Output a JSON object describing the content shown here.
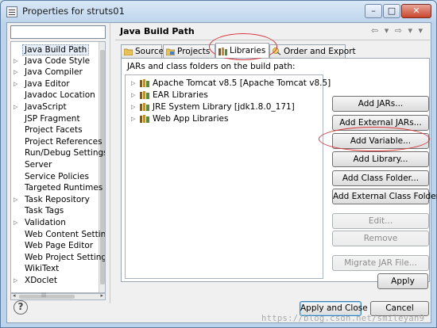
{
  "window": {
    "title": "Properties for struts01",
    "controls": [
      "–",
      "□",
      "✕"
    ]
  },
  "sidebar": {
    "filter_value": "",
    "items": [
      {
        "label": "Java Build Path",
        "expandable": false,
        "selected": true
      },
      {
        "label": "Java Code Style",
        "expandable": true
      },
      {
        "label": "Java Compiler",
        "expandable": true
      },
      {
        "label": "Java Editor",
        "expandable": true
      },
      {
        "label": "Javadoc Location",
        "expandable": false
      },
      {
        "label": "JavaScript",
        "expandable": true
      },
      {
        "label": "JSP Fragment",
        "expandable": false
      },
      {
        "label": "Project Facets",
        "expandable": false
      },
      {
        "label": "Project References",
        "expandable": false
      },
      {
        "label": "Run/Debug Settings",
        "expandable": false
      },
      {
        "label": "Server",
        "expandable": false
      },
      {
        "label": "Service Policies",
        "expandable": false
      },
      {
        "label": "Targeted Runtimes",
        "expandable": false
      },
      {
        "label": "Task Repository",
        "expandable": true
      },
      {
        "label": "Task Tags",
        "expandable": false
      },
      {
        "label": "Validation",
        "expandable": true
      },
      {
        "label": "Web Content Settings",
        "expandable": false
      },
      {
        "label": "Web Page Editor",
        "expandable": false
      },
      {
        "label": "Web Project Settings",
        "expandable": false
      },
      {
        "label": "WikiText",
        "expandable": false
      },
      {
        "label": "XDoclet",
        "expandable": true
      }
    ],
    "scroll_left": "◂",
    "scroll_right": "▸",
    "scroll_grip": "|||"
  },
  "page": {
    "title": "Java Build Path",
    "nav": "⇦ ▾ ⇨ ▾ ▾",
    "tabs": [
      {
        "label": "Source",
        "active": false
      },
      {
        "label": "Projects",
        "active": false
      },
      {
        "label": "Libraries",
        "active": true
      },
      {
        "label": "Order and Export",
        "active": false
      }
    ],
    "list_label": "JARs and class folders on the build path:",
    "libraries": [
      "Apache Tomcat v8.5 [Apache Tomcat v8.5]",
      "EAR Libraries",
      "JRE System Library [jdk1.8.0_171]",
      "Web App Libraries"
    ],
    "buttons": {
      "add_jars": "Add JARs...",
      "add_external_jars": "Add External JARs...",
      "add_variable": "Add Variable...",
      "add_library": "Add Library...",
      "add_class_folder": "Add Class Folder...",
      "add_external_class_folder": "Add External Class Folder...",
      "edit": "Edit...",
      "remove": "Remove",
      "migrate_jar": "Migrate JAR File..."
    },
    "apply": "Apply"
  },
  "footer": {
    "help": "?",
    "apply_and_close": "Apply and Close",
    "cancel": "Cancel",
    "watermark": "https://blog.csdn.net/smileyan9"
  },
  "colors": {
    "highlight_ellipse": "#d8343a",
    "selection": "#e5eef9"
  }
}
